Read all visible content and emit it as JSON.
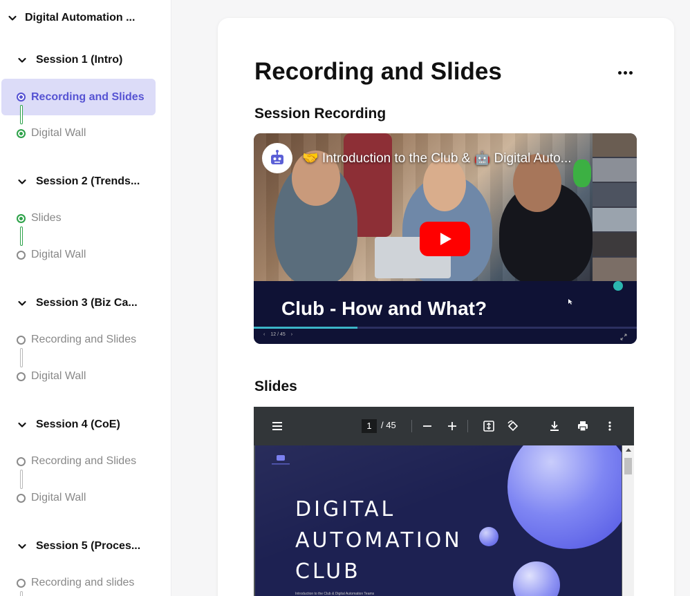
{
  "sidebar": {
    "course_title": "Digital Automation ...",
    "sessions": [
      {
        "label": "Session 1 (Intro)",
        "lessons": [
          {
            "label": "Recording and Slides",
            "state": "current"
          },
          {
            "label": "Digital Wall",
            "state": "done"
          }
        ]
      },
      {
        "label": "Session 2 (Trends...",
        "lessons": [
          {
            "label": "Slides",
            "state": "done"
          },
          {
            "label": "Digital Wall",
            "state": "todo"
          }
        ]
      },
      {
        "label": "Session 3 (Biz Ca...",
        "lessons": [
          {
            "label": "Recording and Slides",
            "state": "todo"
          },
          {
            "label": "Digital Wall",
            "state": "todo"
          }
        ]
      },
      {
        "label": "Session 4 (CoE)",
        "lessons": [
          {
            "label": "Recording and Slides",
            "state": "todo"
          },
          {
            "label": "Digital Wall",
            "state": "todo"
          }
        ]
      },
      {
        "label": "Session 5 (Proces...",
        "lessons": [
          {
            "label": "Recording and slides",
            "state": "todo"
          }
        ]
      }
    ]
  },
  "main": {
    "title": "Recording and Slides",
    "more_icon": "more-horizontal-icon",
    "recording_heading": "Session Recording",
    "slides_heading": "Slides"
  },
  "video": {
    "title": "🤝 Introduction to the Club & 🤖 Digital Auto...",
    "caption": "Club - How and What?",
    "slide_counter": "12 / 45",
    "progress": 0.27,
    "play_icon": "play-icon"
  },
  "pdf": {
    "current_page": "1",
    "total_pages": "/ 45",
    "slide_title_lines": [
      "DIGITAL",
      "AUTOMATION",
      "CLUB"
    ],
    "slide_subtitle": "Introduction to the Club & Digital Automation Teams"
  },
  "colors": {
    "accent": "#5653d3",
    "active_bg": "#dcdcf8",
    "done": "#2ea24a",
    "pdf_toolbar": "#323639",
    "slide_bg": "#1d2152"
  }
}
